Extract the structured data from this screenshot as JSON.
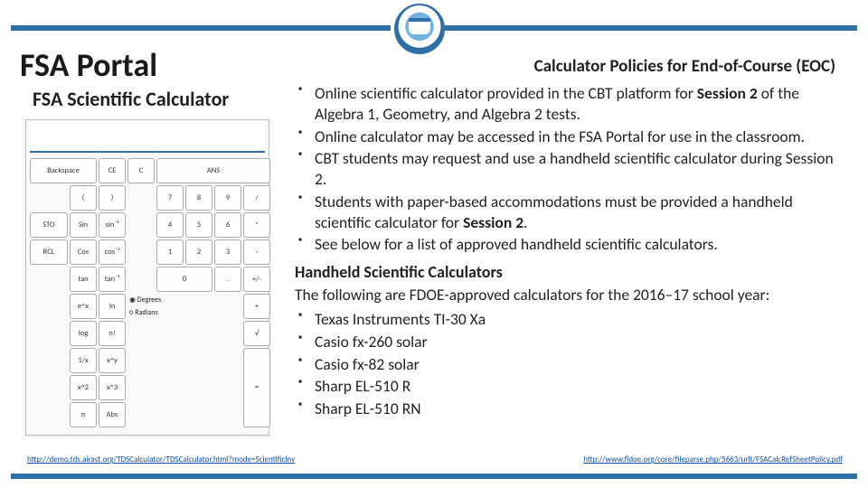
{
  "title": "FSA Portal",
  "right_heading": "Calculator Policies for End-of-Course (EOC)",
  "left_heading": "FSA Scientific Calculator",
  "policies": [
    "Online scientific calculator provided in the CBT platform for <b>Session 2</b> of the Algebra 1, Geometry, and Algebra 2 tests.",
    "Online calculator may be accessed in the FSA Portal for use in the classroom.",
    "CBT students may request and use a handheld scientific calculator during Session 2.",
    "Students with paper-based accommodations must be provided a handheld scientific calculator for <b>Session 2</b>.",
    "See below for a list of approved handheld scientific calculators."
  ],
  "handheld_heading": "Handheld Scientific Calculators",
  "handheld_intro": "The following are FDOE-approved calculators for the 2016–17 school year:",
  "handheld_list": [
    "Texas Instruments TI-30 Xa",
    "Casio fx-260 solar",
    "Casio fx-82 solar",
    "Sharp EL-510 R",
    "Sharp EL-510 RN"
  ],
  "link_left": "http://demo.tds.airast.org/TDSCalculator/TDSCalculator.html?mode=ScientificInv",
  "link_right": "http://www.fldoe.org/core/fileparse.php/5663/urlt/FSACalcRefSheetPolicy.pdf",
  "calc": {
    "row0": [
      "Backspace",
      "CE",
      "C",
      "ANS",
      "",
      "",
      "",
      ""
    ],
    "row1": [
      "",
      "(",
      ")",
      "",
      "7",
      "8",
      "9",
      "/"
    ],
    "row2": [
      "STO",
      "Sin",
      "sin⁻¹",
      "",
      "4",
      "5",
      "6",
      "*"
    ],
    "row3": [
      "RCL",
      "Cos",
      "cos⁻¹",
      "",
      "1",
      "2",
      "3",
      "-"
    ],
    "row4": [
      "",
      "tan",
      "tan⁻¹",
      "",
      "",
      "0",
      ".",
      "+/-"
    ],
    "row5": [
      "",
      "e^x",
      "In",
      "",
      "",
      "",
      "",
      "+"
    ],
    "row6": [
      "",
      "log",
      "n!",
      "",
      "",
      "",
      "",
      "√"
    ],
    "row7": [
      "",
      "1/x",
      "x^y",
      "",
      "",
      "",
      "",
      "="
    ],
    "row8": [
      "",
      "x^2",
      "x^3",
      "",
      "",
      "",
      "",
      ""
    ],
    "row9": [
      "",
      "π",
      "Abs",
      "",
      "",
      "",
      "",
      ""
    ],
    "radio1": "Degrees",
    "radio2": "Radians"
  }
}
